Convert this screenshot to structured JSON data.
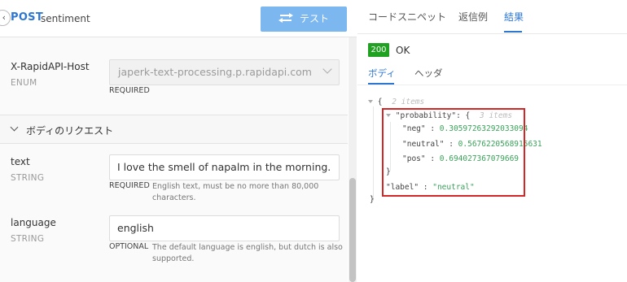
{
  "request": {
    "method": "POST",
    "endpoint": "sentiment",
    "test_label": "テスト",
    "partial_marker": "ᵕ"
  },
  "header_param": {
    "name": "X-RapidAPI-Host",
    "type": "ENUM",
    "value": "japerk-text-processing.p.rapidapi.com",
    "requirement": "REQUIRED"
  },
  "body_section": {
    "title": "ボディのリクエスト"
  },
  "body_params": [
    {
      "name": "text",
      "type": "STRING",
      "value": "I love the smell of napalm in the morning.",
      "requirement": "REQUIRED",
      "description": "English text, must be no more than 80,000 characters."
    },
    {
      "name": "language",
      "type": "STRING",
      "value": "english",
      "requirement": "OPTIONAL",
      "description_line1": "The default language is english, but dutch is also",
      "description_line2": "supported."
    }
  ],
  "response_tabs": [
    "コードスニペット",
    "返信例",
    "結果"
  ],
  "active_tab": "結果",
  "status": {
    "code": "200",
    "text": "OK",
    "color": "#21a121"
  },
  "sub_tabs": [
    "ボディ",
    "ヘッダ"
  ],
  "json_view": {
    "root_open": "{",
    "root_count": "2 items",
    "probability_key": "\"probability\"",
    "probability_open": ": {",
    "probability_count": "3 items",
    "neg_key": "\"neg\"",
    "neg_value": "0.30597263292033094",
    "neutral_key": "\"neutral\"",
    "neutral_value": "0.5676220568915631",
    "pos_key": "\"pos\"",
    "pos_value": "0.694027367079669",
    "probability_close": "}",
    "label_key": "\"label\"",
    "label_value": "\"neutral\"",
    "root_close": "}"
  },
  "colors": {
    "accent": "#2d77d2",
    "button": "#7cb7f0",
    "json_value": "#3aa35a",
    "highlight": "#d42626"
  }
}
